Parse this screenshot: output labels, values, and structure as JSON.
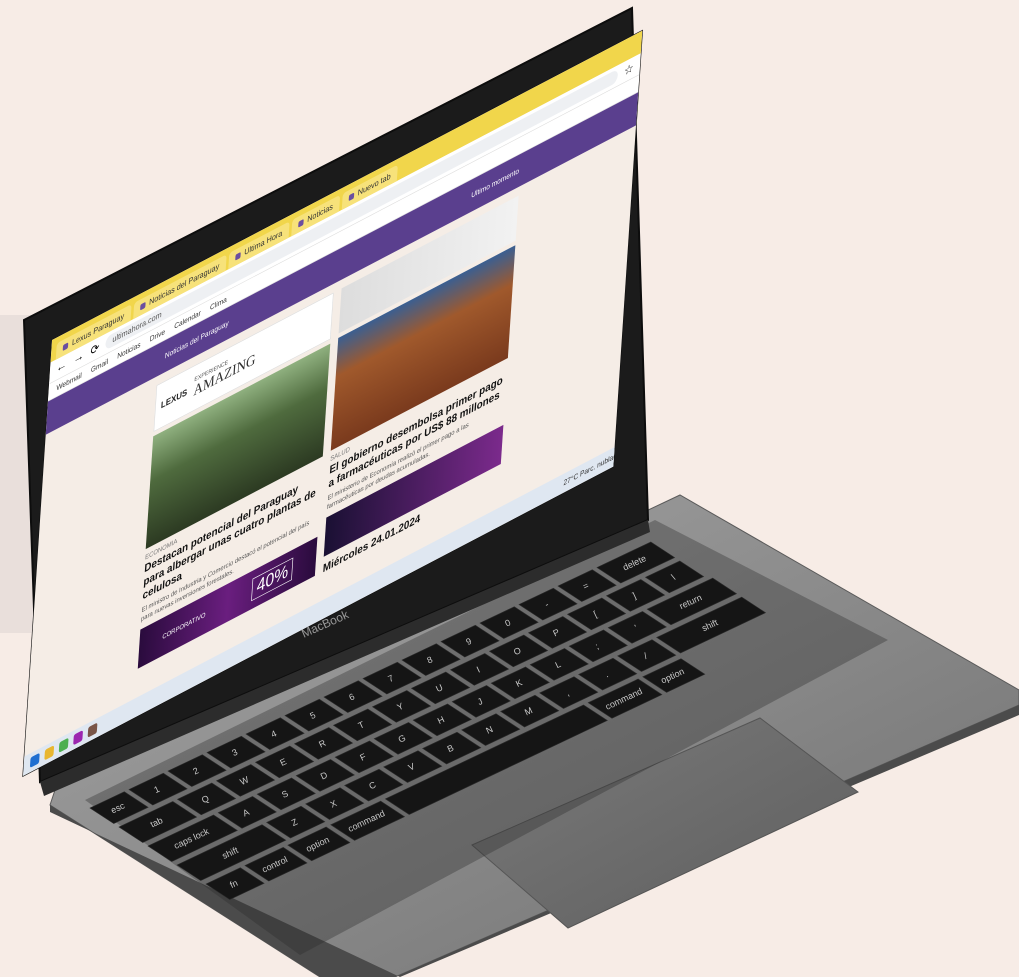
{
  "colors": {
    "background": "#f7ece6",
    "site_header": "#5a3f8e",
    "browser_tabbar": "#f1d64b",
    "laptop_body": "#8c8c8c",
    "key": "#151515"
  },
  "device": {
    "brand_label": "MacBook"
  },
  "browser": {
    "tabs": [
      {
        "label": "Lexus Paraguay"
      },
      {
        "label": "Noticias del Paraguay"
      },
      {
        "label": "Ultima Hora"
      },
      {
        "label": "Noticias"
      },
      {
        "label": "Nuevo tab"
      }
    ],
    "address": "ultimahora.com",
    "bookmarks": [
      "Webmail",
      "Gmail",
      "Noticias",
      "Drive",
      "Calendar",
      "Clima"
    ]
  },
  "site": {
    "header_left": "Noticias del Paraguay",
    "header_right": "Ultimo momento"
  },
  "ads": {
    "lexus_logo": "LEXUS",
    "lexus_tagline_1": "EXPERIENCE",
    "lexus_tagline_2": "AMAZING",
    "promo_percent": "40%",
    "promo_label": "CORPORATIVO"
  },
  "articles": [
    {
      "kicker": "ECONOMIA",
      "headline": "Destacan potencial del Paraguay para albergar unas cuatro plantas de celulosa",
      "teaser": "El ministro de Industria y Comercio destacó el potencial del país para nuevas inversiones forestales."
    },
    {
      "kicker": "SALUD",
      "headline": "El gobierno desembolsa primer pago a farmacéuticas por US$ 88 millones",
      "teaser": "El ministerio de Economía realizó el primer pago a las farmacéuticas por deudas acumuladas."
    }
  ],
  "date_label": "Miércoles 24.01.2024",
  "taskbar": {
    "weather": "27°C Parc. nublado"
  },
  "keyboard": {
    "row1": [
      "esc",
      "1",
      "2",
      "3",
      "4",
      "5",
      "6",
      "7",
      "8",
      "9",
      "0",
      "-",
      "=",
      "delete"
    ],
    "row2": [
      "tab",
      "Q",
      "W",
      "E",
      "R",
      "T",
      "Y",
      "U",
      "I",
      "O",
      "P",
      "[",
      "]",
      "\\"
    ],
    "row3": [
      "caps lock",
      "A",
      "S",
      "D",
      "F",
      "G",
      "H",
      "J",
      "K",
      "L",
      ";",
      "'",
      "return"
    ],
    "row4": [
      "shift",
      "Z",
      "X",
      "C",
      "V",
      "B",
      "N",
      "M",
      ",",
      ".",
      "/",
      "shift"
    ],
    "row5": [
      "fn",
      "control",
      "option",
      "command",
      "",
      "command",
      "option"
    ]
  }
}
